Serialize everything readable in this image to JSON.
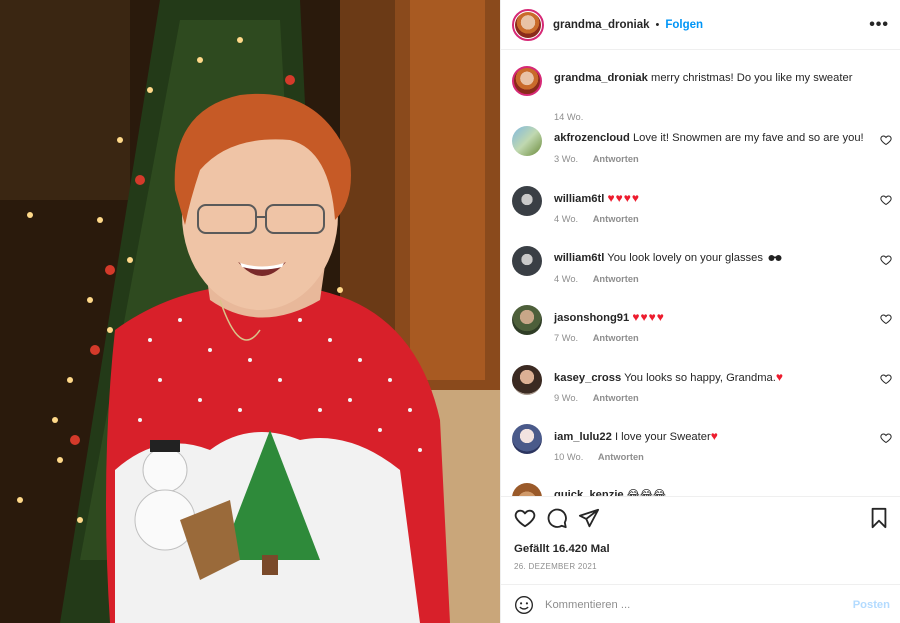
{
  "post": {
    "username": "grandma_droniak",
    "separator": "•",
    "follow_label": "Folgen",
    "more_label": "•••"
  },
  "comments": [
    {
      "user": "grandma_droniak",
      "text": "merry christmas! Do you like my sweater",
      "time": "14 Wo.",
      "reply": "",
      "hearts": ""
    },
    {
      "user": "akfrozencloud",
      "text": "Love it! Snowmen are my fave and so are you!",
      "time": "3 Wo.",
      "reply": "Antworten",
      "hearts": ""
    },
    {
      "user": "william6tl",
      "text": "",
      "time": "4 Wo.",
      "reply": "Antworten",
      "hearts": "♥♥♥♥"
    },
    {
      "user": "william6tl",
      "text": "You look lovely on your glasses",
      "time": "4 Wo.",
      "reply": "Antworten",
      "hearts": ""
    },
    {
      "user": "jasonshong91",
      "text": "",
      "time": "7 Wo.",
      "reply": "Antworten",
      "hearts": "♥♥♥♥"
    },
    {
      "user": "kasey_cross",
      "text": "You looks so happy, Grandma.",
      "time": "9 Wo.",
      "reply": "Antworten",
      "hearts": "♥"
    },
    {
      "user": "iam_lulu22",
      "text": "I love your Sweater",
      "time": "10 Wo.",
      "reply": "Antworten",
      "hearts": "♥"
    },
    {
      "user": "quick_kenzie",
      "text": "😂😂😂",
      "time": "",
      "reply": "",
      "hearts": ""
    }
  ],
  "actions": {
    "likes": "Gefällt 16.420 Mal",
    "date": "26. DEZEMBER 2021"
  },
  "compose": {
    "placeholder": "Kommentieren ...",
    "post_label": "Posten"
  },
  "colors": {
    "link": "#0095f6",
    "heart": "#ed1c2e",
    "muted": "#8e8e8e",
    "post_disabled": "#b3dbff"
  }
}
